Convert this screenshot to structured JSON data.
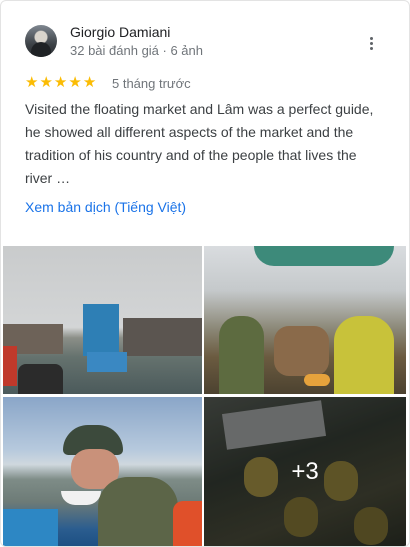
{
  "reviewer": {
    "name": "Giorgio Damiani",
    "meta": "32 bài đánh giá · 6 ảnh"
  },
  "review": {
    "rating": 5,
    "max_rating": 5,
    "date": "5 tháng trước",
    "text": "Visited the floating market and Lâm was a perfect guide, he showed all different aspects of the market and the tradition of his country and of the people that lives the river …",
    "translate_label": "Xem bản dịch (Tiếng Việt)"
  },
  "photos": {
    "more_count": "+3"
  },
  "icons": {
    "more": "more-vert-icon",
    "star": "star-icon"
  },
  "colors": {
    "star": "#fbbc04",
    "link": "#1a73e8",
    "name": "#202124",
    "meta": "#70757a"
  }
}
